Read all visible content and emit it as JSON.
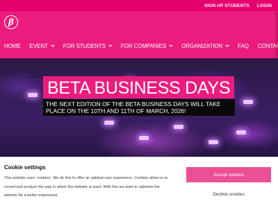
{
  "topbar": {
    "signup_label": "SIGN UP STUDENTS",
    "login_label": "LOGIN"
  },
  "logo": {
    "glyph": "β",
    "icon": "beta-logo-icon"
  },
  "nav": {
    "home": "HOME",
    "event": "EVENT",
    "students": "FOR STUDENTS",
    "companies": "FOR COMPANIES",
    "organization": "ORGANIZATION",
    "faq": "FAQ",
    "contact": "CONTACT"
  },
  "hero": {
    "title": "BETA BUSINESS DAYS",
    "subtitle": "THE NEXT EDITION OF THE BETA BUSINESS DAYS WILL TAKE PLACE ON THE 10TH AND 11TH OF MARCH, 2026!"
  },
  "cookie": {
    "heading": "Cookie settings",
    "body": "This website uses 'cookies'. We do this to offer an optimal user experience. Cookies allow us to record and analyze the way in which the website is used. With this we want to optimize the website for a better experience.",
    "accept_label": "Accept cookies",
    "decline_label": "Decline cookies"
  },
  "colors": {
    "brand_pink": "#ec1c7e",
    "accept_pink": "#ec4f95",
    "topbar_pink": "#e6006e"
  }
}
